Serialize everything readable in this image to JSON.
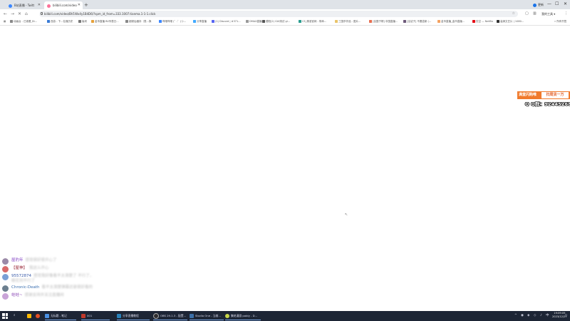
{
  "browser": {
    "tabs": [
      {
        "title": "B站直播 - Twitt",
        "icon_color": "#3a86ff",
        "active": false
      },
      {
        "title": "bilibili.com/video",
        "icon_color": "#fb7299",
        "active": true
      }
    ],
    "new_tab": "+",
    "update_label": "更新",
    "minimize": "—",
    "maximize": "☐",
    "close": "✕",
    "url": "bilibili.com/video/BV1Wx4y1B4D6/?spm_id_from=333.1007.tianma.1-1-1.click",
    "profile_label": "我的工具 ▾",
    "bookmarks": [
      {
        "label": "动画台 - 已观看_Bi...",
        "color": "#888"
      },
      {
        "label": "西游 - 下...社媒历史",
        "color": "#3a7bd5"
      },
      {
        "label": "版块",
        "color": "#777"
      },
      {
        "label": "金币直播 BV列表日...",
        "color": "#e6a23c"
      },
      {
        "label": "超频后缓存（表...换",
        "color": "#888"
      },
      {
        "label": "哔哩哔哩 (゜-゜)つ...",
        "color": "#3a86ff"
      },
      {
        "label": "分享直播",
        "color": "#40a9ff"
      },
      {
        "label": "(1) Discord | #371...",
        "color": "#5865f2"
      },
      {
        "label": "DMAX直播",
        "color": "#999"
      },
      {
        "label": "德阳(2) GUI测试 gi...",
        "color": "#555"
      },
      {
        "label": "CS_精准官网 - 带命...",
        "color": "#2a9d8f"
      },
      {
        "label": "三国杀作品 - 图片...",
        "color": "#e9c46a"
      },
      {
        "label": "[全国子榜] 中国直播...",
        "color": "#e76f51"
      },
      {
        "label": "[全站子] 不要尝新 (...",
        "color": "#6d597a"
      },
      {
        "label": "金币直播_金币直播...",
        "color": "#f4a261"
      },
      {
        "label": "仅空 — Netflix",
        "color": "#e50914"
      },
      {
        "label": "高清文艺片 | 1080...",
        "color": "#333"
      }
    ],
    "bookmarks_more": "» 所有书签"
  },
  "overlay": {
    "banner_left": "满堂闪购唯",
    "banner_right": "扫周货一万",
    "qq_text": "Q Q群：924452683"
  },
  "chat": [
    {
      "name": "屋豹年",
      "name_color": "#8a4ec7",
      "text": "感觉很好很开心了",
      "avatar_color": "#9b8aa8"
    },
    {
      "name": "【屋神】",
      "name_color": "#9b2a3a",
      "text": "我这么开心",
      "avatar_color": "#d96a6a"
    },
    {
      "name": "95572874",
      "name_color": "#3a5ba9",
      "text": "感觉我好像看不太清楚了 不行了，眼花到不行了",
      "avatar_color": "#7aa0d6"
    },
    {
      "name": "Chronic-Death",
      "name_color": "#3a6fb0",
      "text": "看不太清楚弹幕还是很好看的",
      "avatar_color": "#6c7f8f"
    },
    {
      "name": "蛙蛙~",
      "name_color": "#9a5fbf",
      "text": "感谢支持并关注直播间",
      "avatar_color": "#c9a4d8"
    }
  ],
  "taskbar": {
    "apps": [
      {
        "label": "",
        "color": "#ffb900"
      },
      {
        "label": "",
        "color": "#e34f26"
      },
      {
        "label": "",
        "color": "#3b82f6"
      },
      {
        "label": "无标题 - 笔记",
        "color": "#4a90e2"
      },
      {
        "label": "001",
        "color": "#c0392b"
      },
      {
        "label": "分享直播教程",
        "color": "#2980b9"
      },
      {
        "label": "OBS 29.1.3 - 配置...",
        "color": "#302e31"
      },
      {
        "label": "Studio One - 当前...",
        "color": "#3b6fa8"
      },
      {
        "label": "集结漫游 pobly - D...",
        "color": "#c8d64a"
      }
    ],
    "clock_time": "19:09:09",
    "clock_date": "2023/12/27"
  }
}
